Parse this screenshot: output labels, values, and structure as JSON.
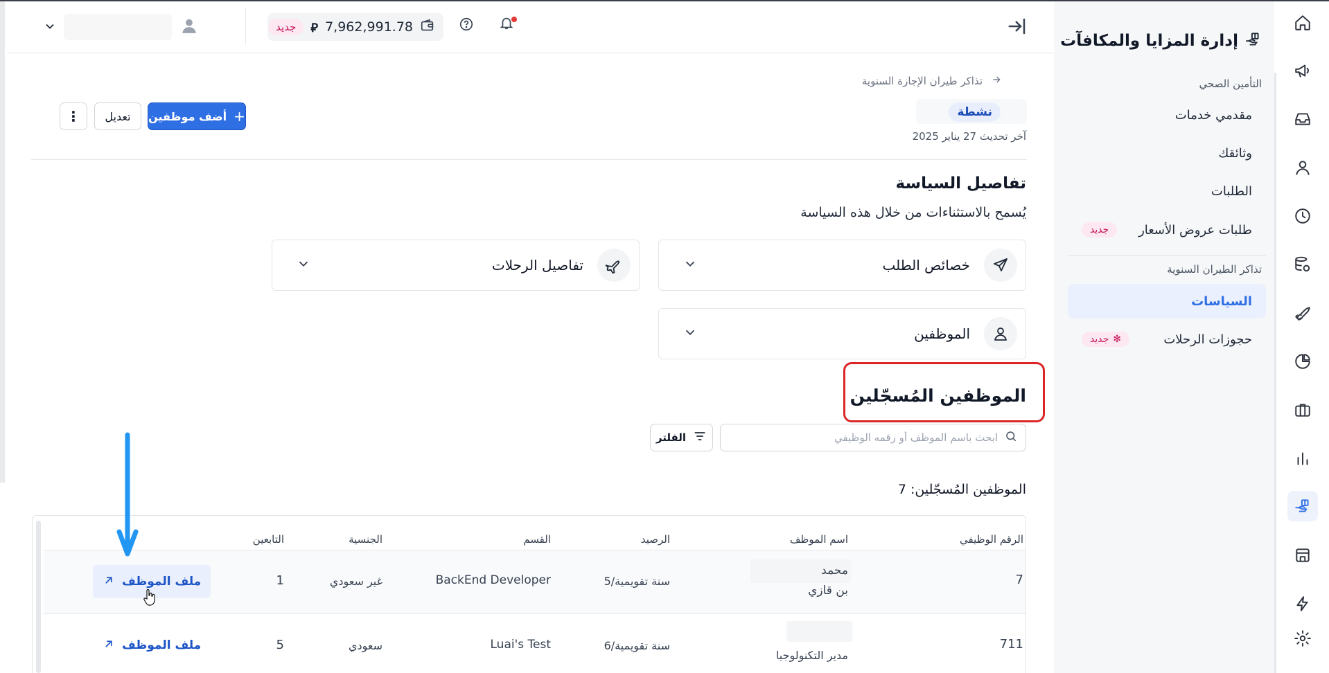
{
  "header": {
    "balance": "7,962,991.78",
    "currency_symbol": "⃁",
    "wallet_badge": "جديد"
  },
  "sidebar": {
    "title": "إدارة المزايا والمكافآت",
    "group1_label": "التأمين الصحي",
    "group1_items": [
      {
        "label": "مقدمي خدمات"
      },
      {
        "label": "وثائقك"
      },
      {
        "label": "الطلبات"
      },
      {
        "label": "طلبات عروض الأسعار",
        "badge": "جديد"
      }
    ],
    "group2_label": "تذاكر الطيران السنوية",
    "group2_items": [
      {
        "label": "السياسات"
      },
      {
        "label": "حجوزات الرحلات",
        "badge": "جديد"
      }
    ]
  },
  "page": {
    "breadcrumb": "تذاكر طيران الإجازة السنوية",
    "status": "نشطة",
    "last_updated": "آخر تحديث 27 يناير 2025",
    "add_button": "أضف موظفين",
    "edit_button": "تعديل",
    "more_button": "⋮",
    "policy_title": "تفاصيل السياسة",
    "policy_subtitle": "يُسمح بالاستثناءات من خلال هذه السياسة",
    "accordions": {
      "request_properties": "خصائص الطلب",
      "trip_details": "تفاصيل الرحلات",
      "employees": "الموظفين"
    },
    "enrolled_title": "الموظفين المُسجّلين",
    "search_placeholder": "ابحث باسم الموظف أو رقمه الوظيفي",
    "filter_button": "الفلتر",
    "enrolled_count": "الموظفين المُسجّلين: 7"
  },
  "table": {
    "columns": [
      "الرقم الوظيفي",
      "اسم الموظف",
      "الرصيد",
      "القسم",
      "الجنسية",
      "التابعين"
    ],
    "rows": [
      {
        "id": "7",
        "name_line1": "محمد",
        "name_line2": "بن قازي",
        "balance": "5/سنة تقويمية",
        "department": "BackEnd Developer",
        "nationality": "غير سعودي",
        "dependents": "1",
        "action": "ملف الموظف"
      },
      {
        "id": "711",
        "name_line1": "",
        "name_line2": "مدير التكنولوجيا",
        "balance": "6/سنة تقويمية",
        "department": "Luai's Test",
        "nationality": "سعودي",
        "dependents": "5",
        "action": "ملف الموظف"
      }
    ]
  },
  "colors": {
    "accent": "#2f6fe4",
    "highlight_box": "#dc2626",
    "annotation_arrow": "#2196f3",
    "badge_pink": "#c2185b"
  },
  "icons": {
    "rail": [
      "home-icon",
      "megaphone-icon",
      "inbox-icon",
      "user-icon",
      "clock-icon",
      "database-icon",
      "rocket-icon",
      "pie-chart-icon",
      "briefcase-icon",
      "bar-chart-icon",
      "hand-gift-icon",
      "store-icon",
      "bolt-icon",
      "gear-icon"
    ]
  }
}
